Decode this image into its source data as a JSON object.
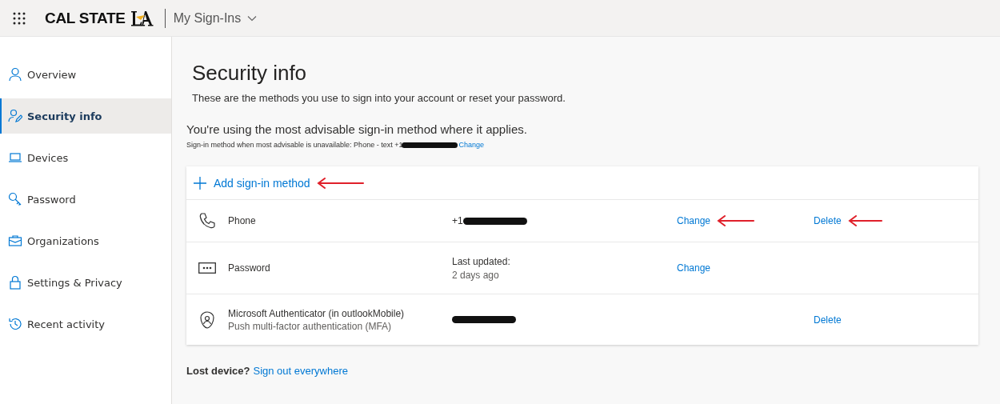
{
  "header": {
    "brand": "CAL STATE",
    "app_title": "My Sign-Ins"
  },
  "sidebar": {
    "items": [
      {
        "label": "Overview",
        "selected": false
      },
      {
        "label": "Security info",
        "selected": true
      },
      {
        "label": "Devices",
        "selected": false
      },
      {
        "label": "Password",
        "selected": false
      },
      {
        "label": "Organizations",
        "selected": false
      },
      {
        "label": "Settings & Privacy",
        "selected": false
      },
      {
        "label": "Recent activity",
        "selected": false
      }
    ]
  },
  "main": {
    "title": "Security info",
    "subtitle": "These are the methods you use to sign into your account or reset your password.",
    "advisable": "You're using the most advisable sign-in method where it applies.",
    "fallback": {
      "text": "Sign-in method when most advisable is unavailable: Phone - text +1",
      "redacted": true,
      "link": "Change"
    },
    "add_method": {
      "label": "Add sign-in method",
      "annotated": true
    },
    "methods": [
      {
        "name": "Phone",
        "value": "+1",
        "redacted": true,
        "actions": [
          {
            "label": "Change",
            "annotated": true,
            "kind": "change"
          },
          {
            "label": "Delete",
            "annotated": true,
            "kind": "delete"
          }
        ]
      },
      {
        "name": "Password",
        "value_label": "Last updated:",
        "value": "2 days ago",
        "redacted": false,
        "actions": [
          {
            "label": "Change",
            "annotated": false,
            "kind": "change"
          }
        ]
      },
      {
        "name": "Microsoft Authenticator (in outlookMobile)",
        "detail": "Push multi-factor authentication (MFA)",
        "redacted": true,
        "actions": [
          {
            "label": "Delete",
            "annotated": false,
            "kind": "delete"
          }
        ]
      }
    ],
    "lost_device": {
      "label": "Lost device?",
      "link": "Sign out everywhere"
    }
  }
}
